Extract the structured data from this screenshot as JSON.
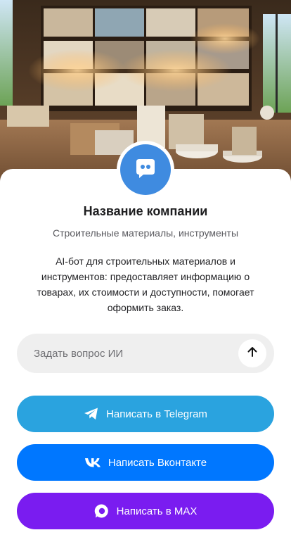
{
  "company": {
    "title": "Название компании",
    "subtitle": "Строительные материалы, инструменты",
    "description": "AI-бот для строительных материалов и инструментов: предоставляет информацию о товарах, их стоимости и доступности, помогает оформить заказ."
  },
  "ask": {
    "placeholder": "Задать вопрос ИИ",
    "value": "",
    "send_icon": "arrow-up-icon"
  },
  "buttons": {
    "telegram": {
      "label": "Написать в Telegram",
      "color": "#2aa3df",
      "icon": "telegram-icon"
    },
    "vk": {
      "label": "Написать Вконтакте",
      "color": "#0077ff",
      "icon": "vk-icon"
    },
    "max": {
      "label": "Написать в MAX",
      "color": "#7a1cf0",
      "icon": "max-icon"
    }
  },
  "colors": {
    "avatar": "#3f8be0",
    "input_bg": "#efefef"
  },
  "avatar_icon": "chat-bot-icon"
}
